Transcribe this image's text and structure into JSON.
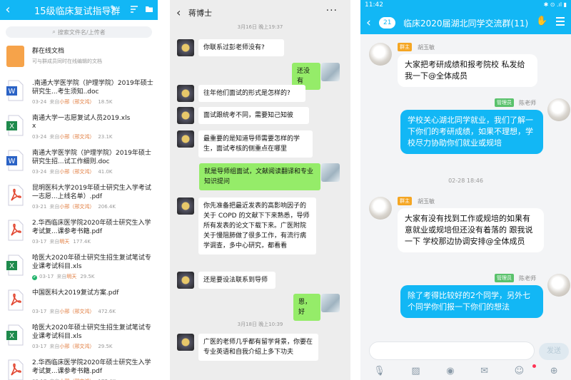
{
  "files_panel": {
    "title": "15级临床复试指导群",
    "search_placeholder": "搜索文件名/上传者",
    "online_doc": {
      "title": "群在线文档",
      "subtitle": "可与群成员同时在线编辑的文档"
    },
    "files": [
      {
        "type": "doc",
        "name": ".南通大学医学院（护理学院）2019年硕士研究生...考生须知..doc",
        "date": "03-24",
        "from": "来自",
        "uploader": "小邢（邢文鸿）",
        "size": "18.5K"
      },
      {
        "type": "xls",
        "name": "南通大学一志愿复试人员2019.xls",
        "name2": "x",
        "date": "03-24",
        "from": "来自",
        "uploader": "小邢（邢文鸿）",
        "size": "23.1K"
      },
      {
        "type": "doc",
        "name": "南通大学医学院（护理学院）2019年硕士研究生招...试工作细则.doc",
        "date": "03-24",
        "from": "来自",
        "uploader": "小邢（邢文鸿）",
        "size": "41.0K"
      },
      {
        "type": "pdf",
        "name": "昆明医科大学2019年硕士研究生入学考试一志愿...上线名单）.pdf",
        "date": "03-21",
        "from": "来自",
        "uploader": "小邢（邢文鸿）",
        "size": "206.4K"
      },
      {
        "type": "pdf",
        "name": "2.华西临床医学院2020年硕士研究生入学考试复...课参考书籍.pdf",
        "date": "03-17",
        "from": "来自",
        "uploader": "明天",
        "size": "177.4K"
      },
      {
        "type": "xls",
        "name": "哈医大2020年硕士研究生招生复试笔试专业课考试科目.xls",
        "date": "03-17",
        "from": "来自",
        "uploader": "明天",
        "size": "29.5K",
        "check": true
      },
      {
        "type": "pdf",
        "name": "中国医科大2019复试方案.pdf",
        "date": "03-17",
        "from": "来自",
        "uploader": "小邢（邢文鸿）",
        "size": "472.6K"
      },
      {
        "type": "xls",
        "name": "哈医大2020年硕士研究生招生复试笔试专业课考试科目.xls",
        "date": "03-17",
        "from": "来自",
        "uploader": "小邢（邢文鸿）",
        "size": "29.5K"
      },
      {
        "type": "pdf",
        "name": "2.华西临床医学院2020年硕士研究生入学考试复...课参考书籍.pdf",
        "date": "03-17",
        "from": "来自",
        "uploader": "小邢（邢文鸿）",
        "size": "177.4K"
      }
    ]
  },
  "wechat_panel": {
    "title": "蒋博士",
    "more": "···",
    "timestamps": [
      "3月16日 晚上19:37",
      "3月18日 晚上10:39"
    ],
    "messages": [
      {
        "side": "left",
        "text": "你联系过彭老师没有?"
      },
      {
        "side": "right",
        "text": "还没有"
      },
      {
        "side": "left",
        "text": "往年他们面试的形式是怎样的?"
      },
      {
        "side": "left",
        "text": "面试跟统考不同，需要知己知彼"
      },
      {
        "side": "left",
        "text": "最重要的是知道导师需要怎样的学生，面试考核的侧重点在哪里"
      },
      {
        "side": "right",
        "text": "就是导师组面试，文献阅读翻译和专业知识提问"
      },
      {
        "side": "left",
        "text": "你先准备把最近发表的高影响因子的关于 COPD 的文献下下来熟悉，导师所有发表的论文下载下来。广医附院关于慢阻肺做了很多工作，有流行病学调查，多中心研究，都看看"
      },
      {
        "side": "left",
        "text": "还是要设法联系到导师"
      },
      {
        "side": "right",
        "text": "恩，好"
      },
      {
        "side": "left",
        "text": "广医的老师几乎都有留学背景，你要在专业英语和自我介绍上多下功夫"
      }
    ]
  },
  "qq_panel": {
    "status_time": "11:42",
    "status_icons": "✱ ⊙ .ıl ▮",
    "badge": "21",
    "title": "临床2020届湖北同学交流群(11)",
    "timestamp": "02-28 18:46",
    "messages": [
      {
        "side": "left",
        "role": "群主",
        "name": "胡玉敏",
        "text": "大家把考研成绩和报考院校 私发给我一下@全体成员"
      },
      {
        "side": "right",
        "role": "管理员",
        "name": "陈老师",
        "text": "学校关心湖北同学就业，我们了解一下你们的考研成绩，如果不理想，学校尽力协助你们就业或规培"
      },
      {
        "side": "left",
        "role": "群主",
        "name": "胡玉敏",
        "text": "大家有没有找到工作或规培的如果有意就业或规培但还没有着落的 跟我说一下 学校那边协调安排@全体成员"
      },
      {
        "side": "right",
        "role": "管理员",
        "name": "陈老师",
        "text": "除了考得比较好的2个同学，另外七个同学你们报一下你们的想法"
      }
    ],
    "send_label": "发送",
    "colors": {
      "accent": "#12b7f5",
      "owner": "#f5a623",
      "admin": "#5ac26c"
    }
  }
}
